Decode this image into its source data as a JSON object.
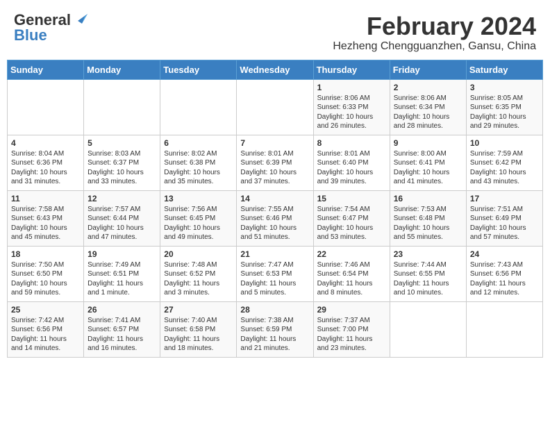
{
  "header": {
    "logo_general": "General",
    "logo_blue": "Blue",
    "title": "February 2024",
    "subtitle": "Hezheng Chengguanzhen, Gansu, China"
  },
  "weekdays": [
    "Sunday",
    "Monday",
    "Tuesday",
    "Wednesday",
    "Thursday",
    "Friday",
    "Saturday"
  ],
  "weeks": [
    [
      {
        "day": "",
        "info": ""
      },
      {
        "day": "",
        "info": ""
      },
      {
        "day": "",
        "info": ""
      },
      {
        "day": "",
        "info": ""
      },
      {
        "day": "1",
        "info": "Sunrise: 8:06 AM\nSunset: 6:33 PM\nDaylight: 10 hours and 26 minutes."
      },
      {
        "day": "2",
        "info": "Sunrise: 8:06 AM\nSunset: 6:34 PM\nDaylight: 10 hours and 28 minutes."
      },
      {
        "day": "3",
        "info": "Sunrise: 8:05 AM\nSunset: 6:35 PM\nDaylight: 10 hours and 29 minutes."
      }
    ],
    [
      {
        "day": "4",
        "info": "Sunrise: 8:04 AM\nSunset: 6:36 PM\nDaylight: 10 hours and 31 minutes."
      },
      {
        "day": "5",
        "info": "Sunrise: 8:03 AM\nSunset: 6:37 PM\nDaylight: 10 hours and 33 minutes."
      },
      {
        "day": "6",
        "info": "Sunrise: 8:02 AM\nSunset: 6:38 PM\nDaylight: 10 hours and 35 minutes."
      },
      {
        "day": "7",
        "info": "Sunrise: 8:01 AM\nSunset: 6:39 PM\nDaylight: 10 hours and 37 minutes."
      },
      {
        "day": "8",
        "info": "Sunrise: 8:01 AM\nSunset: 6:40 PM\nDaylight: 10 hours and 39 minutes."
      },
      {
        "day": "9",
        "info": "Sunrise: 8:00 AM\nSunset: 6:41 PM\nDaylight: 10 hours and 41 minutes."
      },
      {
        "day": "10",
        "info": "Sunrise: 7:59 AM\nSunset: 6:42 PM\nDaylight: 10 hours and 43 minutes."
      }
    ],
    [
      {
        "day": "11",
        "info": "Sunrise: 7:58 AM\nSunset: 6:43 PM\nDaylight: 10 hours and 45 minutes."
      },
      {
        "day": "12",
        "info": "Sunrise: 7:57 AM\nSunset: 6:44 PM\nDaylight: 10 hours and 47 minutes."
      },
      {
        "day": "13",
        "info": "Sunrise: 7:56 AM\nSunset: 6:45 PM\nDaylight: 10 hours and 49 minutes."
      },
      {
        "day": "14",
        "info": "Sunrise: 7:55 AM\nSunset: 6:46 PM\nDaylight: 10 hours and 51 minutes."
      },
      {
        "day": "15",
        "info": "Sunrise: 7:54 AM\nSunset: 6:47 PM\nDaylight: 10 hours and 53 minutes."
      },
      {
        "day": "16",
        "info": "Sunrise: 7:53 AM\nSunset: 6:48 PM\nDaylight: 10 hours and 55 minutes."
      },
      {
        "day": "17",
        "info": "Sunrise: 7:51 AM\nSunset: 6:49 PM\nDaylight: 10 hours and 57 minutes."
      }
    ],
    [
      {
        "day": "18",
        "info": "Sunrise: 7:50 AM\nSunset: 6:50 PM\nDaylight: 10 hours and 59 minutes."
      },
      {
        "day": "19",
        "info": "Sunrise: 7:49 AM\nSunset: 6:51 PM\nDaylight: 11 hours and 1 minute."
      },
      {
        "day": "20",
        "info": "Sunrise: 7:48 AM\nSunset: 6:52 PM\nDaylight: 11 hours and 3 minutes."
      },
      {
        "day": "21",
        "info": "Sunrise: 7:47 AM\nSunset: 6:53 PM\nDaylight: 11 hours and 5 minutes."
      },
      {
        "day": "22",
        "info": "Sunrise: 7:46 AM\nSunset: 6:54 PM\nDaylight: 11 hours and 8 minutes."
      },
      {
        "day": "23",
        "info": "Sunrise: 7:44 AM\nSunset: 6:55 PM\nDaylight: 11 hours and 10 minutes."
      },
      {
        "day": "24",
        "info": "Sunrise: 7:43 AM\nSunset: 6:56 PM\nDaylight: 11 hours and 12 minutes."
      }
    ],
    [
      {
        "day": "25",
        "info": "Sunrise: 7:42 AM\nSunset: 6:56 PM\nDaylight: 11 hours and 14 minutes."
      },
      {
        "day": "26",
        "info": "Sunrise: 7:41 AM\nSunset: 6:57 PM\nDaylight: 11 hours and 16 minutes."
      },
      {
        "day": "27",
        "info": "Sunrise: 7:40 AM\nSunset: 6:58 PM\nDaylight: 11 hours and 18 minutes."
      },
      {
        "day": "28",
        "info": "Sunrise: 7:38 AM\nSunset: 6:59 PM\nDaylight: 11 hours and 21 minutes."
      },
      {
        "day": "29",
        "info": "Sunrise: 7:37 AM\nSunset: 7:00 PM\nDaylight: 11 hours and 23 minutes."
      },
      {
        "day": "",
        "info": ""
      },
      {
        "day": "",
        "info": ""
      }
    ]
  ]
}
